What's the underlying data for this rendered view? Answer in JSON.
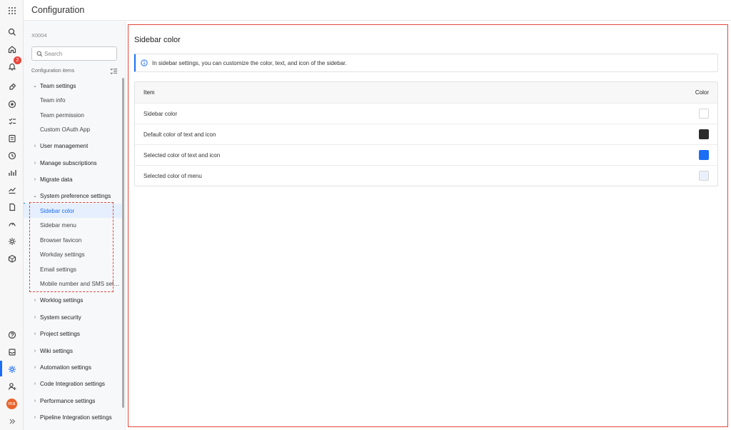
{
  "header": {
    "title": "Configuration"
  },
  "rail": {
    "notification_count": "2",
    "avatar_initials": "ma"
  },
  "sidebar": {
    "workspace_code": "X0004",
    "search_placeholder": "Search",
    "section_label": "Configuration items",
    "groups": [
      {
        "label": "Team settings",
        "expanded": true
      },
      {
        "label": "User management"
      },
      {
        "label": "Manage subscriptions"
      },
      {
        "label": "Migrate data"
      },
      {
        "label": "System preference settings",
        "expanded": true
      },
      {
        "label": "Worklog settings"
      },
      {
        "label": "System security"
      },
      {
        "label": "Project settings"
      },
      {
        "label": "Wiki settings"
      },
      {
        "label": "Automation settings"
      },
      {
        "label": "Code Integration settings"
      },
      {
        "label": "Performance settings"
      },
      {
        "label": "Pipeline Integration settings"
      }
    ],
    "team_children": [
      "Team info",
      "Team permission",
      "Custom OAuth App"
    ],
    "system_pref_children": [
      "Sidebar color",
      "Sidebar menu",
      "Browser favicon",
      "Workday settings",
      "Email settings",
      "Mobile number and SMS settings"
    ],
    "active_item": "Sidebar color"
  },
  "main": {
    "title": "Sidebar color",
    "info_text": "In sidebar settings, you can customize the color, text, and icon of the sidebar.",
    "table": {
      "headers": [
        "Item",
        "Color"
      ],
      "rows": [
        {
          "item": "Sidebar color",
          "color": "#ffffff"
        },
        {
          "item": "Default color of text and icon",
          "color": "#2b2b2b"
        },
        {
          "item": "Selected color of text and icon",
          "color": "#1b6ef3"
        },
        {
          "item": "Selected color of menu",
          "color": "#eaf1fd"
        }
      ]
    }
  },
  "colors": {
    "accent": "#1b6ef3",
    "highlight_border": "#e0473a"
  }
}
